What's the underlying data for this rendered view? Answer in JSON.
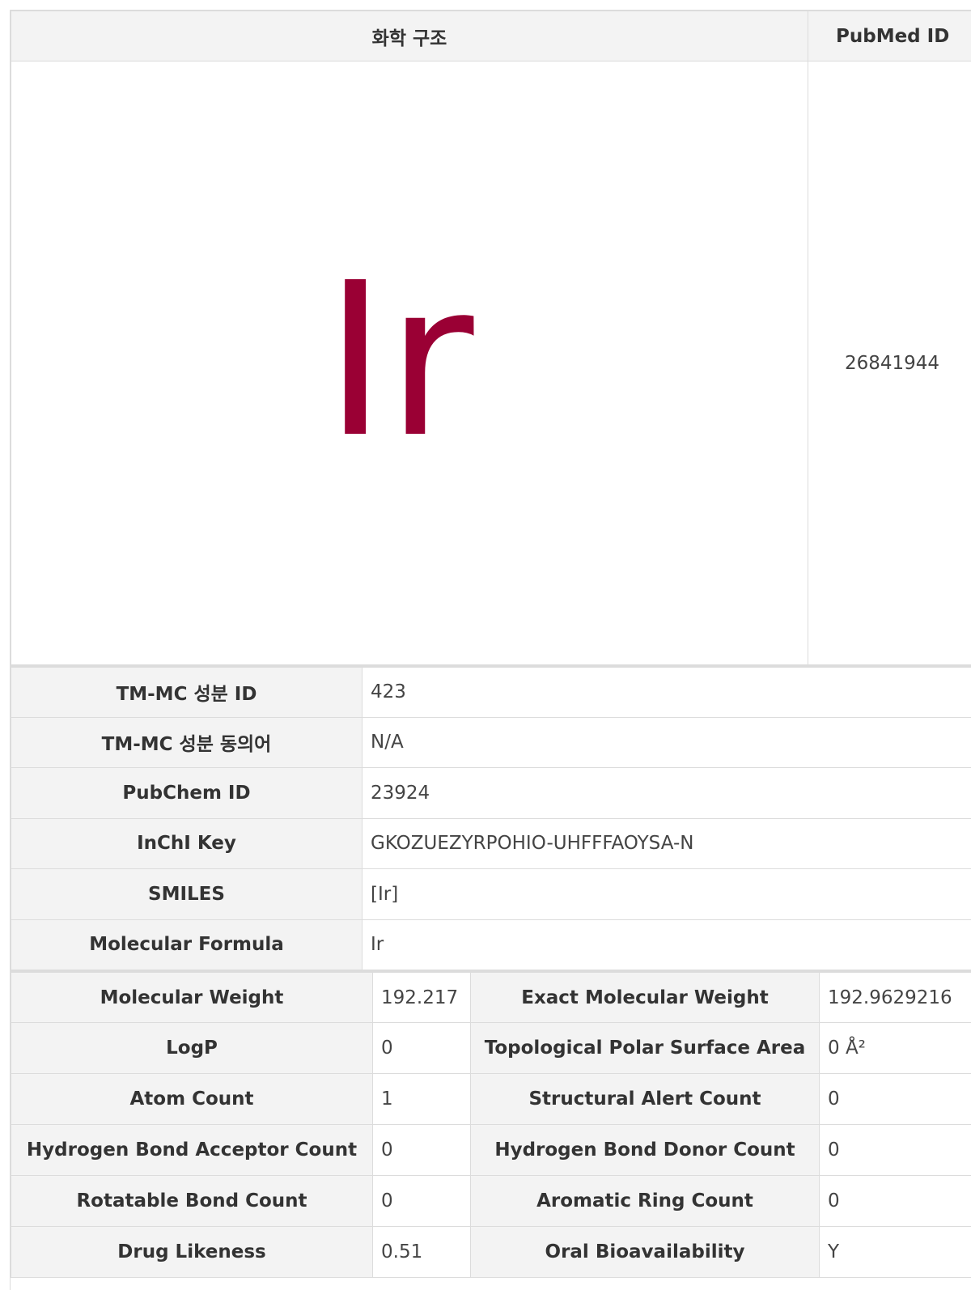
{
  "header": {
    "structure_label": "화학 구조",
    "pubmed_label": "PubMed ID"
  },
  "structure": {
    "symbol": "Ir",
    "color": "#9a0034"
  },
  "pubmed_id": "26841944",
  "identity_rows": [
    {
      "label": "TM-MC 성분 ID",
      "value": "423"
    },
    {
      "label": "TM-MC 성분 동의어",
      "value": "N/A"
    },
    {
      "label": "PubChem ID",
      "value": "23924"
    },
    {
      "label": "InChI Key",
      "value": "GKOZUEZYRPOHIO-UHFFFAOYSA-N"
    },
    {
      "label": "SMILES",
      "value": "[Ir]"
    },
    {
      "label": "Molecular Formula",
      "value": "Ir"
    }
  ],
  "property_rows": [
    {
      "label1": "Molecular Weight",
      "value1": "192.217",
      "label2": "Exact Molecular Weight",
      "value2": "192.9629216"
    },
    {
      "label1": "LogP",
      "value1": "0",
      "label2": "Topological Polar Surface Area",
      "value2": "0 Å²"
    },
    {
      "label1": "Atom Count",
      "value1": "1",
      "label2": "Structural Alert Count",
      "value2": "0"
    },
    {
      "label1": "Hydrogen Bond Acceptor Count",
      "value1": "0",
      "label2": "Hydrogen Bond Donor Count",
      "value2": "0"
    },
    {
      "label1": "Rotatable Bond Count",
      "value1": "0",
      "label2": "Aromatic Ring Count",
      "value2": "0"
    },
    {
      "label1": "Drug Likeness",
      "value1": "0.51",
      "label2": "Oral Bioavailability",
      "value2": "Y"
    }
  ]
}
